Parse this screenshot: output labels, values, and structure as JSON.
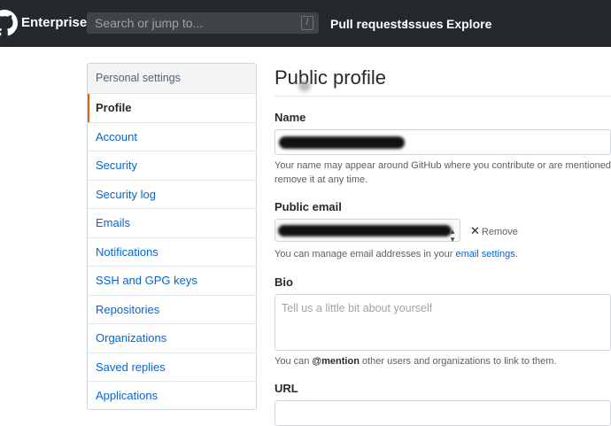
{
  "header": {
    "brand": "Enterprise",
    "search_placeholder": "Search or jump to...",
    "search_shortcut": "/",
    "nav": [
      "Pull requests",
      "Issues",
      "Explore"
    ]
  },
  "sidebar": {
    "heading": "Personal settings",
    "items": [
      {
        "label": "Profile",
        "selected": true
      },
      {
        "label": "Account"
      },
      {
        "label": "Security"
      },
      {
        "label": "Security log"
      },
      {
        "label": "Emails"
      },
      {
        "label": "Notifications"
      },
      {
        "label": "SSH and GPG keys"
      },
      {
        "label": "Repositories"
      },
      {
        "label": "Organizations"
      },
      {
        "label": "Saved replies"
      },
      {
        "label": "Applications"
      }
    ]
  },
  "main": {
    "title": "Public profile",
    "name": {
      "label": "Name",
      "help_line1": "Your name may appear around GitHub where you contribute or are mentioned. You",
      "help_line2": "remove it at any time."
    },
    "public_email": {
      "label": "Public email",
      "remove_label": "Remove",
      "help_prefix": "You can manage email addresses in your ",
      "help_link": "email settings",
      "help_suffix": "."
    },
    "bio": {
      "label": "Bio",
      "placeholder": "Tell us a little bit about yourself",
      "help_prefix": "You can ",
      "help_mention": "@mention",
      "help_suffix": " other users and organizations to link to them."
    },
    "url": {
      "label": "URL"
    }
  },
  "colors": {
    "header_bg": "#24292e",
    "link": "#0366d6",
    "selected_marker": "#e36209"
  }
}
